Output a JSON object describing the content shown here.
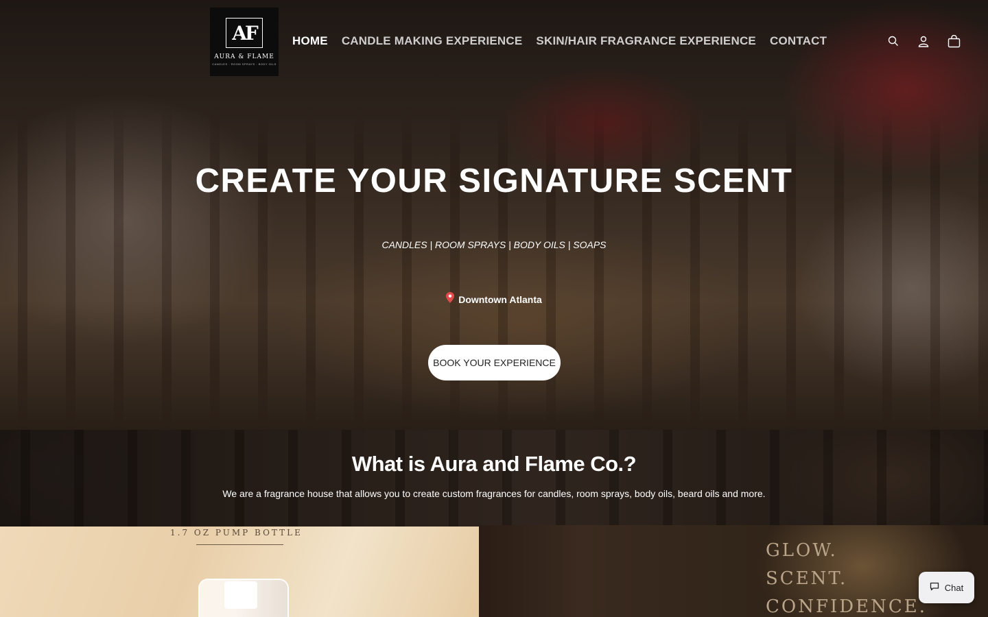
{
  "brand": {
    "mark": "AF",
    "name": "AURA & FLAME",
    "tagline": "CANDLES · ROOM SPRAYS · BODY OILS"
  },
  "nav": {
    "items": [
      {
        "label": "HOME",
        "active": true
      },
      {
        "label": "CANDLE MAKING EXPERIENCE",
        "active": false
      },
      {
        "label": "SKIN/HAIR FRAGRANCE EXPERIENCE",
        "active": false
      },
      {
        "label": "CONTACT",
        "active": false
      }
    ]
  },
  "header_icons": [
    "search-icon",
    "account-icon",
    "cart-icon"
  ],
  "hero": {
    "title": "CREATE YOUR SIGNATURE SCENT",
    "subtitle": "CANDLES | ROOM SPRAYS | BODY OILS | SOAPS",
    "location": "Downtown Atlanta",
    "location_icon": "pin-icon",
    "cta": "BOOK YOUR EXPERIENCE"
  },
  "about": {
    "title": "What is Aura and Flame Co.?",
    "text": "We are a fragrance house that allows you to create custom fragrances for candles, room sprays, body oils, beard oils and more."
  },
  "tiles": {
    "left_caption": "1.7 OZ PUMP BOTTLE",
    "right_lines": [
      "GLOW.",
      "SCENT.",
      "CONFIDENCE."
    ]
  },
  "chat": {
    "label": "Chat",
    "icon": "chat-bubble-icon"
  },
  "colors": {
    "accent": "#ffffff",
    "pin": "#e34b4b",
    "logo_bg": "#0c0c0c"
  }
}
